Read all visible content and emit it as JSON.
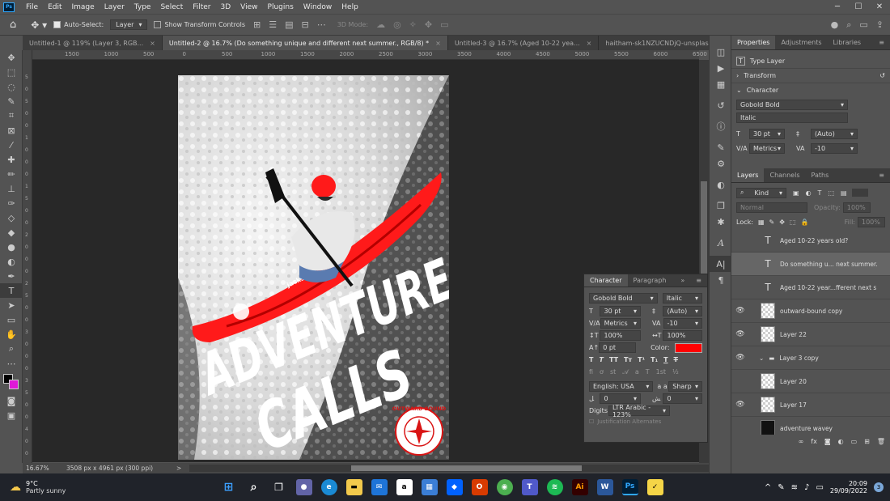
{
  "menubar": {
    "items": [
      "File",
      "Edit",
      "Image",
      "Layer",
      "Type",
      "Select",
      "Filter",
      "3D",
      "View",
      "Plugins",
      "Window",
      "Help"
    ],
    "logo_text": "Ps"
  },
  "options": {
    "auto_select_label": "Auto-Select:",
    "auto_select_value": "Layer",
    "transform_label": "Show Transform Controls",
    "mode_3d": "3D Mode:"
  },
  "tabs": [
    {
      "label": "Untitled-1 @ 119% (Layer 3, RGB..."
    },
    {
      "label": "Untitled-2 @ 16.7% (Do something unique and different next summer., RGB/8) *"
    },
    {
      "label": "Untitled-3 @ 16.7% (Aged 10-22 yea..."
    },
    {
      "label": "haitham-sk1NZUCNDjQ-unsplash.jpg"
    }
  ],
  "ruler_h": [
    "1500",
    "1000",
    "500",
    "0",
    "500",
    "1000",
    "1500",
    "2000",
    "2500",
    "3000",
    "3500",
    "4000",
    "4500",
    "5000",
    "5500",
    "6000",
    "6500"
  ],
  "ruler_v": [
    "5",
    "0",
    "5",
    "0",
    "0",
    "1",
    "0",
    "0",
    "0",
    "1",
    "5",
    "0",
    "0",
    "2",
    "0",
    "0",
    "0",
    "2",
    "5",
    "0",
    "0",
    "3",
    "0",
    "0",
    "0",
    "3",
    "5",
    "0",
    "0",
    "4",
    "0",
    "0",
    "0"
  ],
  "status": {
    "zoom": "16.67%",
    "info": "3508 px x 4961 px (300 ppi)"
  },
  "poster": {
    "line1": "ADVENTURE",
    "line2": "CALLS",
    "brand": "OUTWARD BOUND",
    "kayak_brand": "jackson"
  },
  "properties": {
    "tabs": [
      "Properties",
      "Adjustments",
      "Libraries"
    ],
    "type_layer": "Type Layer",
    "transform": "Transform",
    "character": "Character",
    "font": "Gobold Bold",
    "style": "Italic",
    "size": "30 pt",
    "leading": "(Auto)",
    "kerning": "Metrics",
    "tracking": "-10"
  },
  "layers": {
    "tabs": [
      "Layers",
      "Channels",
      "Paths"
    ],
    "kind": "Kind",
    "blend": "Normal",
    "opacity_label": "Opacity:",
    "opacity": "100%",
    "lock_label": "Lock:",
    "fill_label": "Fill:",
    "fill": "100%",
    "items": [
      {
        "name": "Aged 10-22 years old?",
        "type": "text",
        "visible": false,
        "selected": false
      },
      {
        "name": "Do something u... next summer.",
        "type": "text",
        "visible": false,
        "selected": true
      },
      {
        "name": "Aged 10-22 year...fferent next s",
        "type": "text",
        "visible": false,
        "selected": false
      },
      {
        "name": "outward-bound copy",
        "type": "raster",
        "visible": true,
        "selected": false
      },
      {
        "name": "Layer 22",
        "type": "raster",
        "visible": true,
        "selected": false
      },
      {
        "name": "Layer 3 copy",
        "type": "group",
        "visible": true,
        "selected": false
      },
      {
        "name": "Layer 20",
        "type": "raster",
        "visible": false,
        "selected": false
      },
      {
        "name": "Layer 17",
        "type": "raster",
        "visible": true,
        "selected": false
      },
      {
        "name": "adventure wavey",
        "type": "dark",
        "visible": false,
        "selected": false
      }
    ]
  },
  "charpanel": {
    "tabs": [
      "Character",
      "Paragraph"
    ],
    "font": "Gobold Bold",
    "style": "Italic",
    "size": "30 pt",
    "leading": "(Auto)",
    "kerning": "Metrics",
    "tracking": "-10",
    "vscale": "100%",
    "hscale": "100%",
    "baseline": "0 pt",
    "color_label": "Color:",
    "color": "#ff0000",
    "language": "English: USA",
    "aa_label": "a a",
    "antialias": "Sharp",
    "v1": "0",
    "v2": "0",
    "digits_label": "Digits",
    "digits": "LTR Arabic - 123%",
    "justification": "Justification Alternates"
  },
  "taskbar": {
    "weather_temp": "9°C",
    "weather_desc": "Partly sunny",
    "time": "20:09",
    "date": "29/09/2022",
    "notif": "3"
  }
}
